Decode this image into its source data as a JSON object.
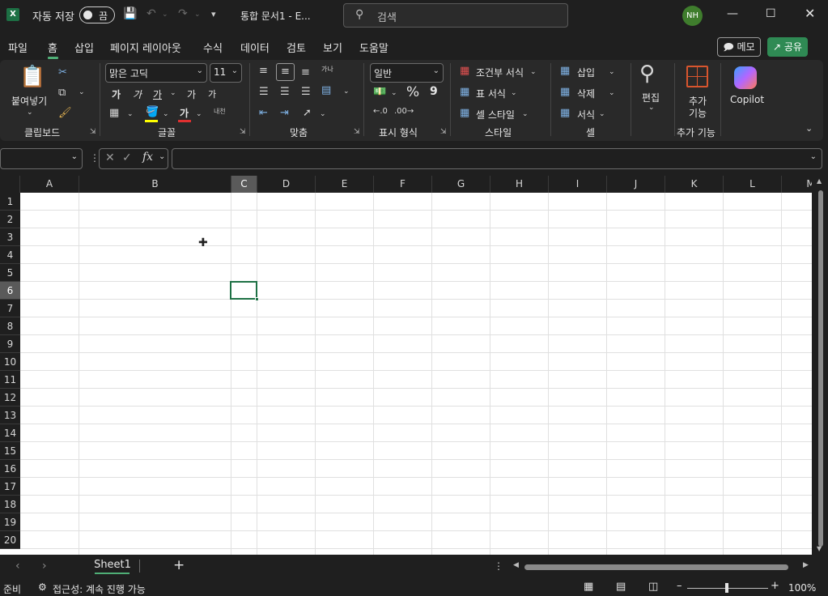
{
  "titlebar": {
    "app_icon": "X",
    "autosave_label": "자동 저장",
    "autosave_state": "끔",
    "doc_title": "통합 문서1  -  E...",
    "search_placeholder": "검색",
    "avatar_initials": "NH"
  },
  "menu": {
    "tabs": [
      "파일",
      "홈",
      "삽입",
      "페이지 레이아웃",
      "수식",
      "데이터",
      "검토",
      "보기",
      "도움말"
    ],
    "active_tab": "홈",
    "memo_label": "메모",
    "share_label": "공유"
  },
  "ribbon": {
    "clipboard": {
      "paste_label": "붙여넣기",
      "group_label": "클립보드"
    },
    "font": {
      "font_name": "맑은 고딕",
      "font_size": "11",
      "bold": "가",
      "italic": "가",
      "underline": "가",
      "grow": "가",
      "shrink": "가",
      "font_color": "가",
      "phonetic": "내천",
      "group_label": "글꼴"
    },
    "alignment": {
      "wrap": "가나",
      "group_label": "맞춤"
    },
    "number": {
      "format": "일반",
      "percent": "%",
      "comma": "9",
      "group_label": "표시 형식"
    },
    "styles": {
      "conditional": "조건부 서식",
      "table": "표 서식",
      "cell_styles": "셀 스타일",
      "group_label": "스타일"
    },
    "cells": {
      "insert": "삽입",
      "delete": "삭제",
      "format": "서식",
      "group_label": "셀"
    },
    "editing": {
      "label": "편집"
    },
    "addins": {
      "label_line1": "추가",
      "label_line2": "기능",
      "group_label": "추가 기능"
    },
    "copilot": {
      "label": "Copilot"
    }
  },
  "formula": {
    "fx": "fx"
  },
  "grid": {
    "columns": [
      "A",
      "B",
      "C",
      "D",
      "E",
      "F",
      "G",
      "H",
      "I",
      "J",
      "K",
      "L",
      "M"
    ],
    "rows": [
      "1",
      "2",
      "3",
      "4",
      "5",
      "6",
      "7",
      "8",
      "9",
      "10",
      "11",
      "12",
      "13",
      "14",
      "15",
      "16",
      "17",
      "18",
      "19",
      "20"
    ],
    "selected_column": "C",
    "selected_row": "6"
  },
  "sheets": {
    "active": "Sheet1",
    "add": "+"
  },
  "status": {
    "ready": "준비",
    "accessibility": "접근성: 계속 진행 가능",
    "zoom": "100%"
  },
  "colors": {
    "accent": "#1e7145",
    "tab_underline": "#4fae76",
    "share": "#2f8a54"
  }
}
